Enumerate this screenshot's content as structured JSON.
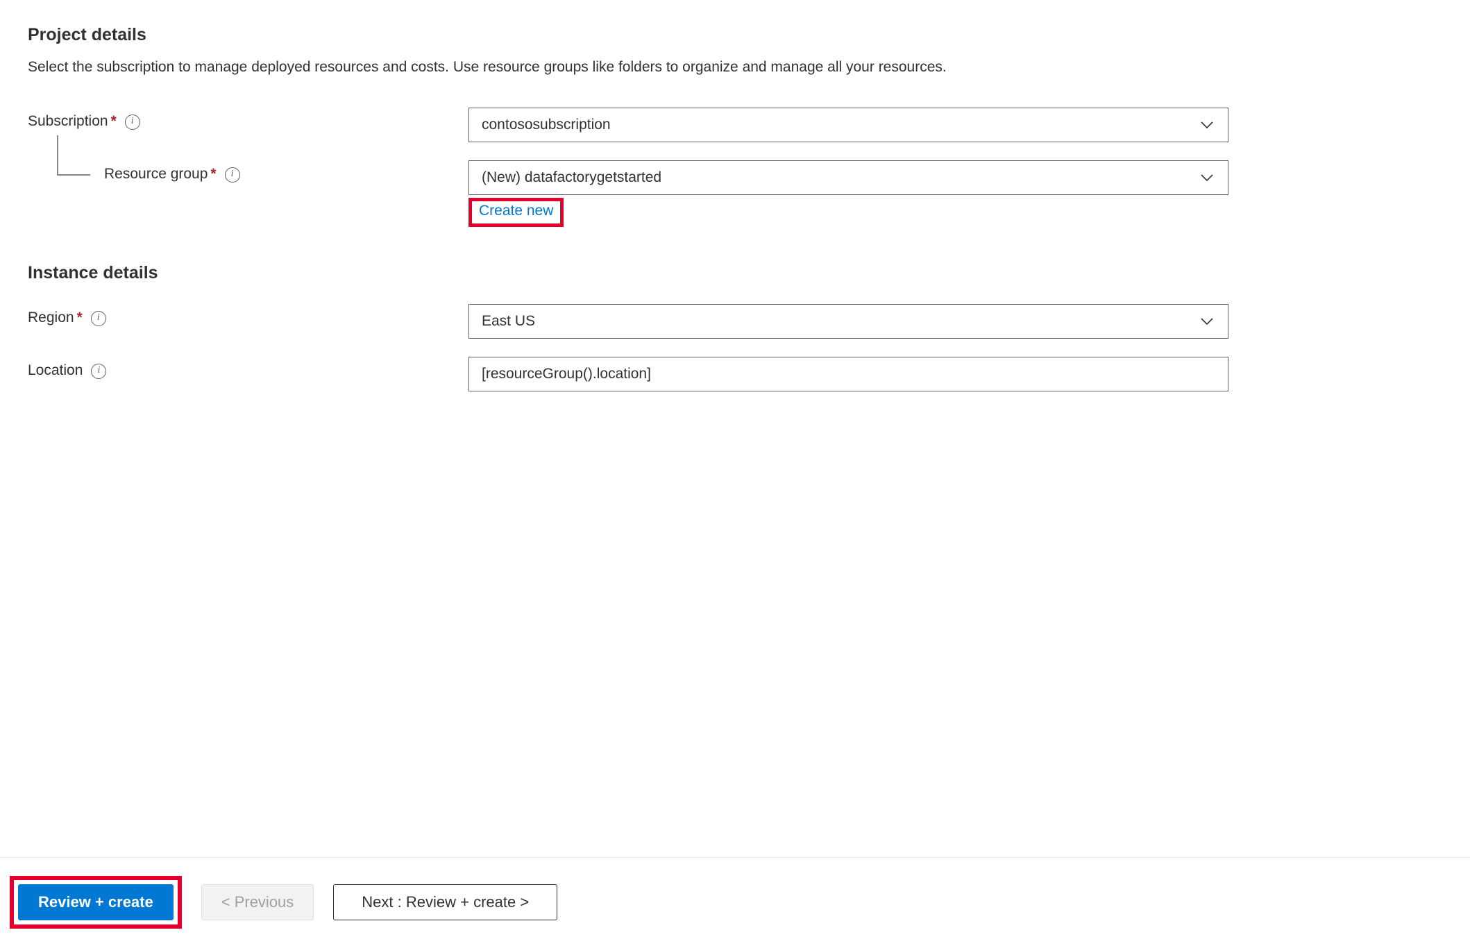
{
  "project_details": {
    "heading": "Project details",
    "description": "Select the subscription to manage deployed resources and costs. Use resource groups like folders to organize and manage all your resources."
  },
  "fields": {
    "subscription": {
      "label": "Subscription",
      "value": "contososubscription"
    },
    "resource_group": {
      "label": "Resource group",
      "value": "(New) datafactorygetstarted",
      "create_new": "Create new"
    },
    "region": {
      "label": "Region",
      "value": "East US"
    },
    "location": {
      "label": "Location",
      "value": "[resourceGroup().location]"
    }
  },
  "instance_details": {
    "heading": "Instance details"
  },
  "footer": {
    "review_create": "Review + create",
    "previous": "< Previous",
    "next": "Next : Review + create >"
  }
}
